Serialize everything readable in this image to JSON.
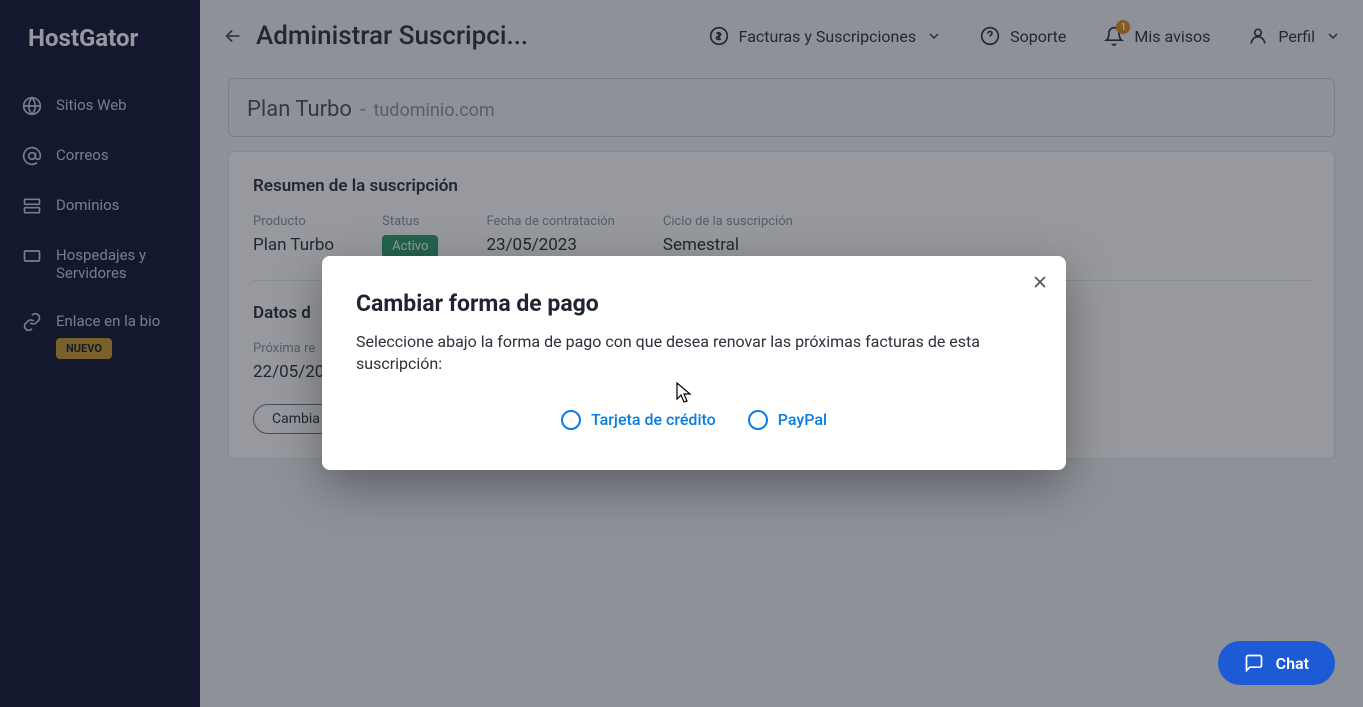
{
  "brand": "HostGator",
  "sidebar": {
    "items": [
      {
        "label": "Sitios Web"
      },
      {
        "label": "Correos"
      },
      {
        "label": "Dominios"
      },
      {
        "label": "Hospedajes y Servidores"
      },
      {
        "label": "Enlace en la bio",
        "badge": "NUEVO"
      }
    ]
  },
  "header": {
    "title": "Administrar Suscripci...",
    "links": {
      "invoices": "Facturas y Suscripciones",
      "support": "Soporte",
      "notices": "Mis avisos",
      "notices_count": "1",
      "profile": "Perfil"
    }
  },
  "banner": {
    "plan": "Plan Turbo",
    "dash": "-",
    "domain": "tudominio.com"
  },
  "summary": {
    "title": "Resumen de la suscripción",
    "product": {
      "label": "Producto",
      "value": "Plan Turbo"
    },
    "status": {
      "label": "Status",
      "value": "Activo"
    },
    "hire_date": {
      "label": "Fecha de contratación",
      "value": "23/05/2023"
    },
    "cycle": {
      "label": "Ciclo de la suscripción",
      "value": "Semestral"
    }
  },
  "payment": {
    "section": "Datos d",
    "next_label": "Próxima re",
    "next_value": "22/05/20",
    "change_btn": "Cambia"
  },
  "modal": {
    "title": "Cambiar forma de pago",
    "desc": "Seleccione abajo la forma de pago con que desea renovar las próximas facturas de esta suscripción:",
    "options": {
      "card": "Tarjeta de crédito",
      "paypal": "PayPal"
    }
  },
  "chat": "Chat"
}
